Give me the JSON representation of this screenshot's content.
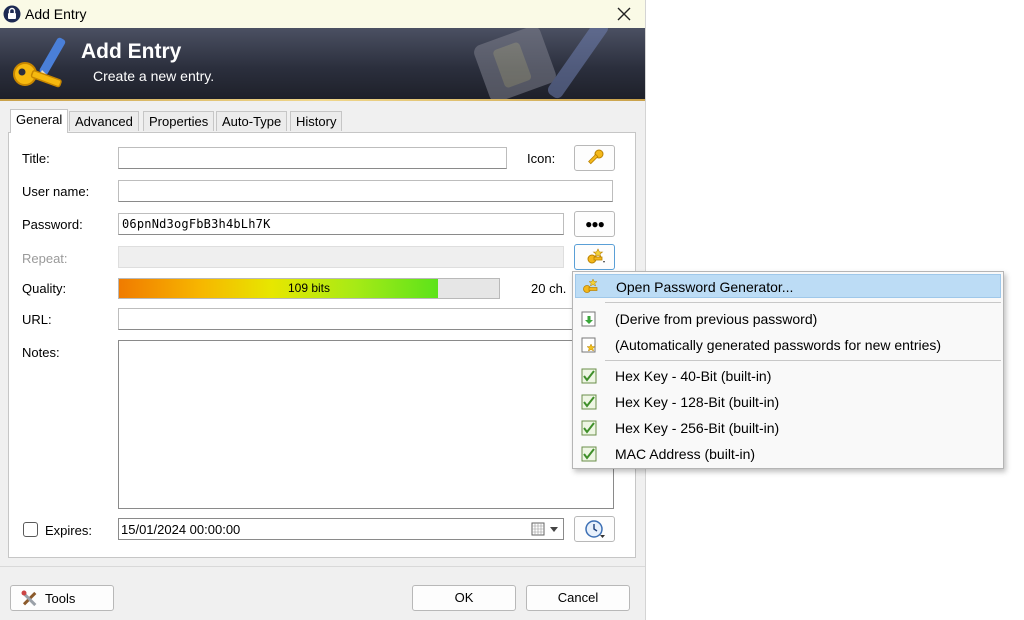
{
  "window": {
    "title": "Add Entry"
  },
  "banner": {
    "title": "Add Entry",
    "subtitle": "Create a new entry."
  },
  "tabs": [
    {
      "label": "General"
    },
    {
      "label": "Advanced"
    },
    {
      "label": "Properties"
    },
    {
      "label": "Auto-Type"
    },
    {
      "label": "History"
    }
  ],
  "form": {
    "title_label": "Title:",
    "title_value": "",
    "icon_label": "Icon:",
    "username_label": "User name:",
    "username_value": "",
    "password_label": "Password:",
    "password_value": "06pnNd3ogFbB3h4bLh7K",
    "repeat_label": "Repeat:",
    "quality_label": "Quality:",
    "quality_text": "109 bits",
    "quality_fraction": 0.84,
    "quality_chars": "20 ch.",
    "url_label": "URL:",
    "notes_label": "Notes:",
    "expires_label": "Expires:",
    "expires_value": "15/01/2024 00:00:00",
    "reveal_glyph": "●●●"
  },
  "footer": {
    "tools_label": "Tools",
    "ok_label": "OK",
    "cancel_label": "Cancel"
  },
  "menu": {
    "items": [
      {
        "label": "Open Password Generator...",
        "icon": "password-generator-icon"
      },
      {
        "label": "(Derive from previous password)",
        "icon": "derive-icon"
      },
      {
        "label": "(Automatically generated passwords for new entries)",
        "icon": "auto-generate-icon"
      },
      {
        "label": "Hex Key - 40-Bit (built-in)",
        "icon": "profile-icon"
      },
      {
        "label": "Hex Key - 128-Bit (built-in)",
        "icon": "profile-icon"
      },
      {
        "label": "Hex Key - 256-Bit (built-in)",
        "icon": "profile-icon"
      },
      {
        "label": "MAC Address (built-in)",
        "icon": "profile-icon"
      }
    ]
  },
  "colors": {
    "banner_dark": "#2b2f3d",
    "menu_highlight": "#bcdcf5",
    "titlebar": "#fafae6"
  }
}
